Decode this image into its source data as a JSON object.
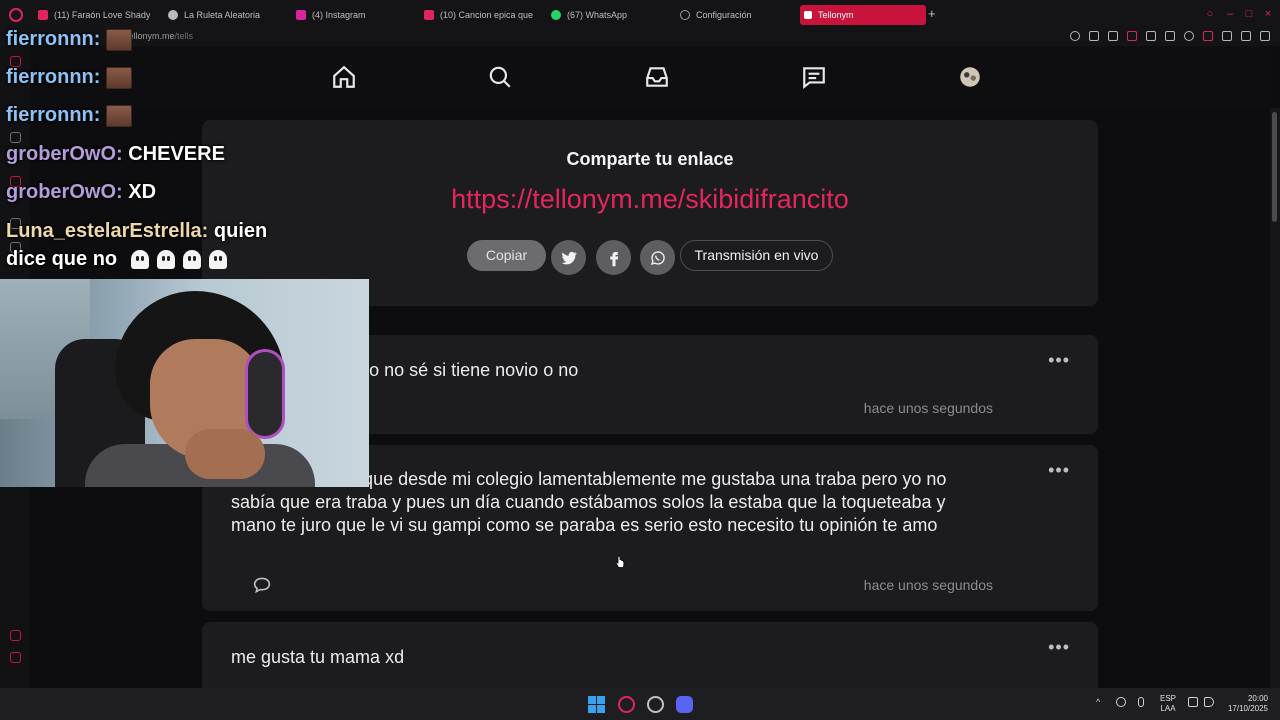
{
  "browser": {
    "tabs": [
      {
        "label": "(11) Faraón Love Shady",
        "color": "#e0245e"
      },
      {
        "label": "La Ruleta Aleatoria",
        "color": "#b9b9c0"
      },
      {
        "label": "(4) Instagram",
        "color": "#d6249f"
      },
      {
        "label": "(10) Cancion epica que u",
        "color": "#e0245e"
      },
      {
        "label": "(67) WhatsApp",
        "color": "#25d366"
      },
      {
        "label": "Configuración",
        "color": "#9c9ca3"
      },
      {
        "label": "Tellonym",
        "color": "#ffffff"
      }
    ],
    "url_host": "tellonym.me",
    "url_path": "/tells",
    "accent": "#c8143c"
  },
  "nav": {
    "icons": [
      "home-icon",
      "search-icon",
      "inbox-icon",
      "chat-icon",
      "profile-avatar"
    ]
  },
  "share": {
    "title": "Comparte tu enlace",
    "link": "https://tellonym.me/skibidifrancito",
    "copy_label": "Copiar",
    "live_label": "Transmisión en vivo",
    "link_color": "#e5265c"
  },
  "tells": [
    {
      "text": "arar a arcane pero no sé si tiene novio o no",
      "time": "hace unos segundos"
    },
    {
      "text": "n firme confieso que desde mi colegio lamentablemente me gustaba una traba pero yo no sabía que era traba y pues un día cuando estábamos solos la estaba que la toqueteaba y mano te juro que le vi su gampi como se paraba es serio esto necesito tu opinión te amo",
      "time": "hace unos segundos"
    },
    {
      "text": "me gusta tu mama xd",
      "time": ""
    }
  ],
  "overlay_chat": [
    {
      "user": "fierronnn:",
      "message": ""
    },
    {
      "user": "fierronnn:",
      "message": ""
    },
    {
      "user": "groberOwO:",
      "message": "CHEVERE"
    },
    {
      "user": "groberOwO:",
      "message": "XD"
    },
    {
      "user": "Luna_estelarEstrella:",
      "message": "quien"
    },
    {
      "user": "",
      "message": "dice que no"
    }
  ],
  "taskbar": {
    "lang_1": "ESP",
    "lang_2": "LAA",
    "time": "20:00",
    "date": "17/10/2025"
  }
}
